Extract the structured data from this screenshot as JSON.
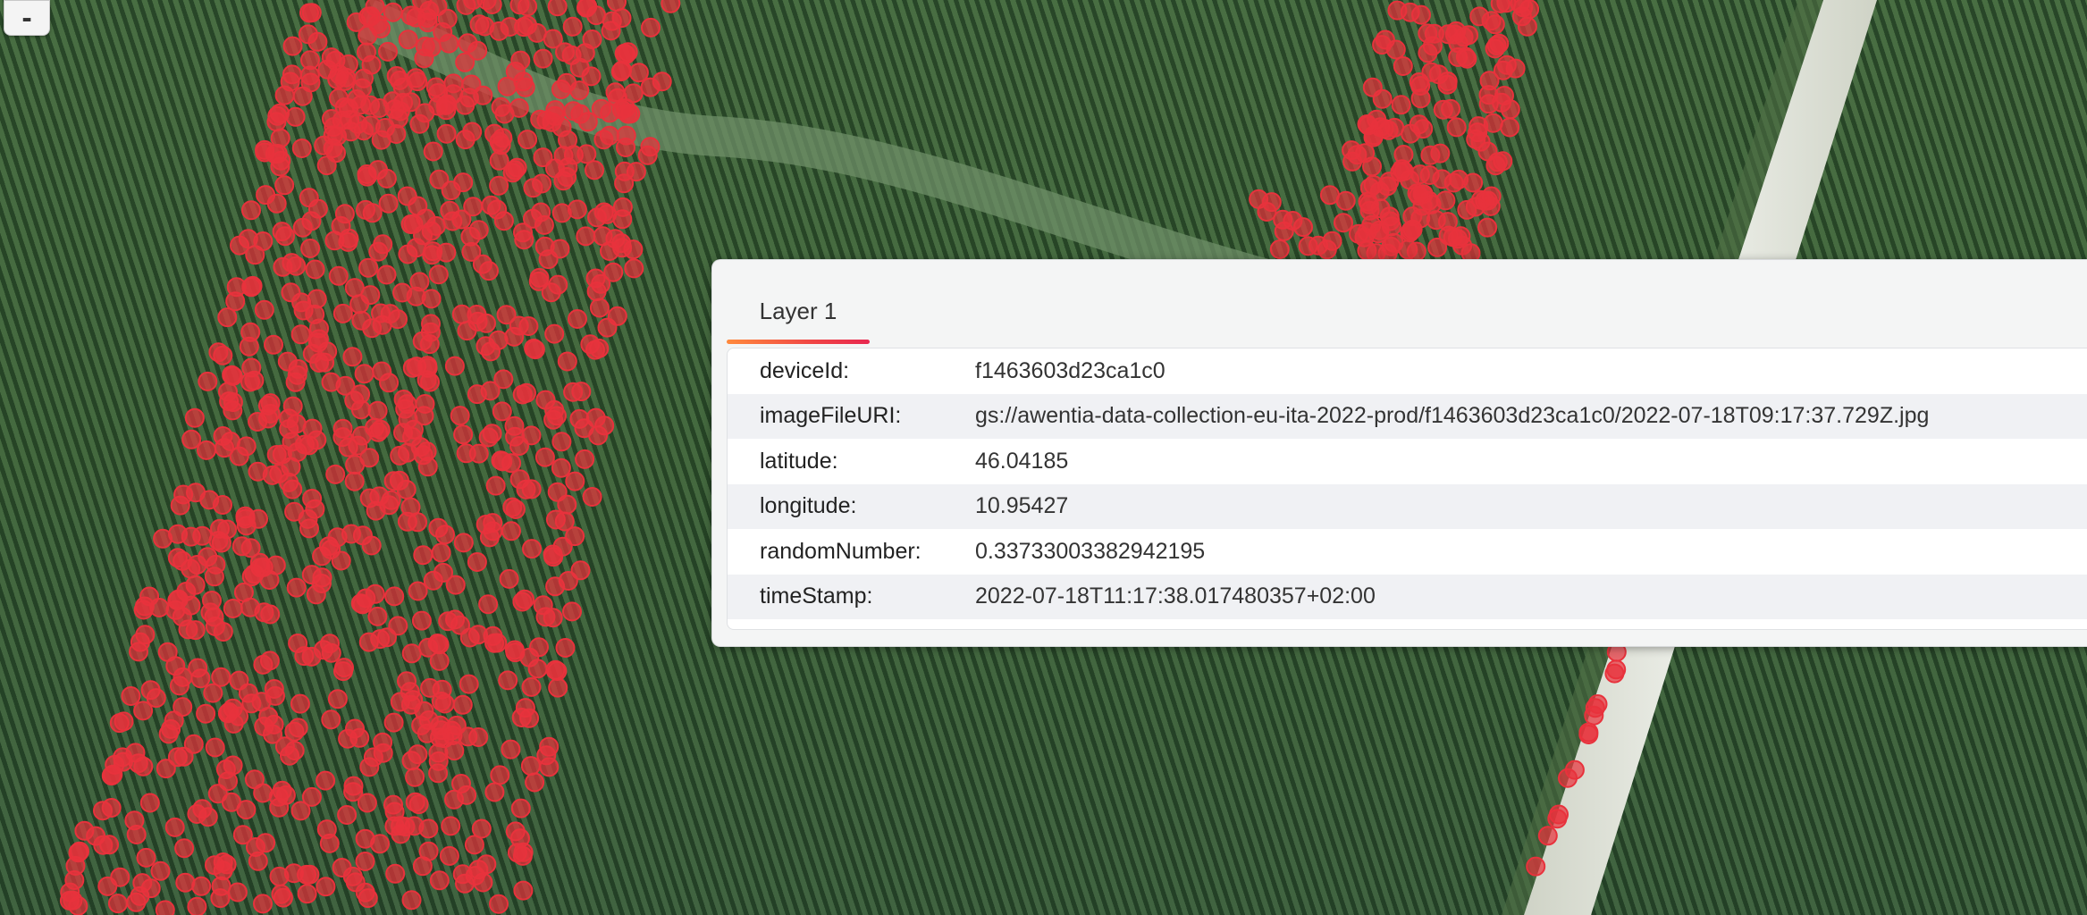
{
  "map": {
    "basemap": "satellite-vineyard",
    "point_color": "#e8323c"
  },
  "controls": {
    "zoom_out_label": "-"
  },
  "popup": {
    "tab_label": "Layer 1",
    "rows": [
      {
        "key": "deviceId:",
        "value": "f1463603d23ca1c0"
      },
      {
        "key": "imageFileURI:",
        "value": "gs://awentia-data-collection-eu-ita-2022-prod/f1463603d23ca1c0/2022-07-18T09:17:37.729Z.jpg"
      },
      {
        "key": "latitude:",
        "value": "46.04185"
      },
      {
        "key": "longitude:",
        "value": "10.95427"
      },
      {
        "key": "randomNumber:",
        "value": "0.33733003382942195"
      },
      {
        "key": "timeStamp:",
        "value": "2022-07-18T11:17:38.017480357+02:00"
      }
    ]
  }
}
